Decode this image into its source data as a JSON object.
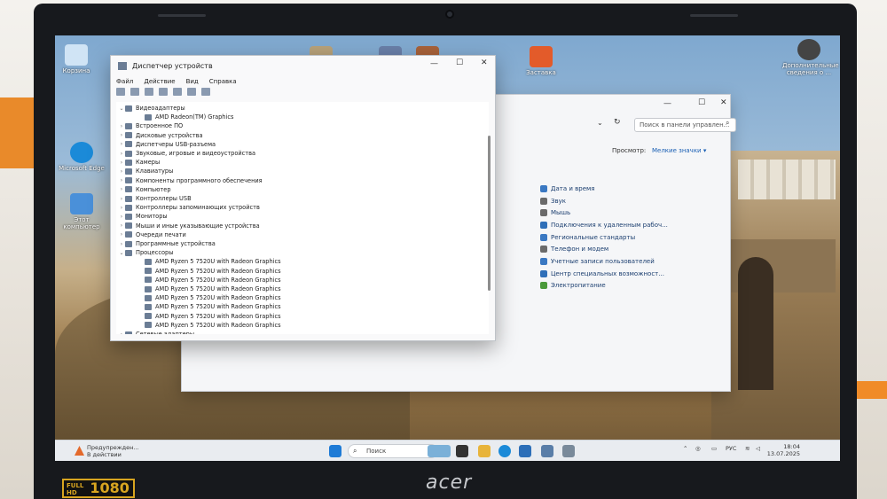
{
  "desktop_icons": [
    {
      "label": "Корзина",
      "color": "#d0e4f5"
    },
    {
      "label": "Microsoft Edge",
      "color": "#1b8ad8"
    },
    {
      "label": "Этот компьютер",
      "color": "#4a90d9"
    },
    {
      "label": "Заставка",
      "color": "#e35b2a"
    },
    {
      "label": "Дополнительные сведения о ...",
      "color": "#444444"
    }
  ],
  "control_panel": {
    "search_placeholder": "Поиск в панели управлен...",
    "view_label": "Просмотр:",
    "view_value": "Мелкие значки ▾",
    "links": [
      {
        "label": "Дата и время",
        "color": "#3a78c2"
      },
      {
        "label": "Звук",
        "color": "#6a6a6a"
      },
      {
        "label": "Мышь",
        "color": "#6a6a6a"
      },
      {
        "label": "Подключения к удаленным рабоч...",
        "color": "#2f6fb8"
      },
      {
        "label": "Региональные стандарты",
        "color": "#3a78c2"
      },
      {
        "label": "Телефон и модем",
        "color": "#6a6a6a"
      },
      {
        "label": "Учетные записи пользователей",
        "color": "#3a78c2"
      },
      {
        "label": "Центр специальных возможност...",
        "color": "#2f6fb8"
      },
      {
        "label": "Электропитание",
        "color": "#4a9a3a"
      }
    ]
  },
  "device_manager": {
    "title": "Диспетчер устройств",
    "menu": [
      "Файл",
      "Действие",
      "Вид",
      "Справка"
    ],
    "tree": [
      {
        "label": "Видеоадаптеры",
        "expanded": true,
        "level": 0
      },
      {
        "label": "AMD Radeon(TM) Graphics",
        "level": 1
      },
      {
        "label": "Встроенное ПО",
        "level": 0
      },
      {
        "label": "Дисковые устройства",
        "level": 0
      },
      {
        "label": "Диспетчеры USB-разъема",
        "level": 0
      },
      {
        "label": "Звуковые, игровые и видеоустройства",
        "level": 0
      },
      {
        "label": "Камеры",
        "level": 0
      },
      {
        "label": "Клавиатуры",
        "level": 0
      },
      {
        "label": "Компоненты программного обеспечения",
        "level": 0
      },
      {
        "label": "Компьютер",
        "level": 0
      },
      {
        "label": "Контроллеры USB",
        "level": 0
      },
      {
        "label": "Контроллеры запоминающих устройств",
        "level": 0
      },
      {
        "label": "Мониторы",
        "level": 0
      },
      {
        "label": "Мыши и иные указывающие устройства",
        "level": 0
      },
      {
        "label": "Очереди печати",
        "level": 0
      },
      {
        "label": "Программные устройства",
        "level": 0
      },
      {
        "label": "Процессоры",
        "expanded": true,
        "level": 0
      },
      {
        "label": "AMD Ryzen 5 7520U with Radeon Graphics",
        "level": 1
      },
      {
        "label": "AMD Ryzen 5 7520U with Radeon Graphics",
        "level": 1
      },
      {
        "label": "AMD Ryzen 5 7520U with Radeon Graphics",
        "level": 1
      },
      {
        "label": "AMD Ryzen 5 7520U with Radeon Graphics",
        "level": 1
      },
      {
        "label": "AMD Ryzen 5 7520U with Radeon Graphics",
        "level": 1
      },
      {
        "label": "AMD Ryzen 5 7520U with Radeon Graphics",
        "level": 1
      },
      {
        "label": "AMD Ryzen 5 7520U with Radeon Graphics",
        "level": 1
      },
      {
        "label": "AMD Ryzen 5 7520U with Radeon Graphics",
        "level": 1
      },
      {
        "label": "Сетевые адаптеры",
        "level": 0
      }
    ]
  },
  "taskbar": {
    "notification_title": "Предупрежден...",
    "notification_sub": "В действии",
    "search_placeholder": "Поиск",
    "tray_lang": "РУС",
    "time": "18:04",
    "date": "13.07.2025",
    "apps": [
      {
        "name": "windows-start",
        "color": "#1e7bd6"
      },
      {
        "name": "task-view",
        "color": "#333333"
      },
      {
        "name": "file-explorer",
        "color": "#e8b43a"
      },
      {
        "name": "edge",
        "color": "#1b8ad8"
      },
      {
        "name": "store",
        "color": "#2d6fb8"
      },
      {
        "name": "control-panel",
        "color": "#5a7ea8"
      },
      {
        "name": "device-manager",
        "color": "#7a8a9a"
      }
    ]
  },
  "laptop": {
    "badge_top": "FULL",
    "badge_bottom": "HD",
    "resolution": "1080",
    "brand": "acer"
  }
}
